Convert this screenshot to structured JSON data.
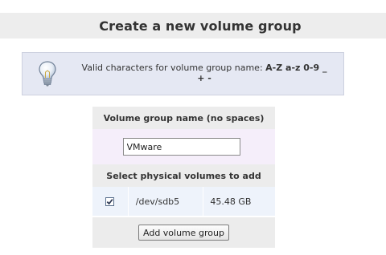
{
  "page": {
    "title": "Create a new volume group"
  },
  "info": {
    "icon": "lightbulb-icon",
    "text_prefix": "Valid characters for volume group name: ",
    "text_chars": "A-Z a-z 0-9 _",
    "text_suffix": "+ -"
  },
  "form": {
    "name_header": "Volume group name (no spaces)",
    "name_value": "VMware",
    "pv_header": "Select physical volumes to add",
    "physical_volumes": [
      {
        "checked": true,
        "device": "/dev/sdb5",
        "size": "45.48 GB"
      }
    ],
    "submit_label": "Add volume group"
  },
  "colors": {
    "title_bg": "#ededed",
    "info_bg": "#e5e8f3",
    "header_bg": "#ececec",
    "input_row_bg": "#f5eefa",
    "pv_row_bg": "#eef3fb"
  }
}
